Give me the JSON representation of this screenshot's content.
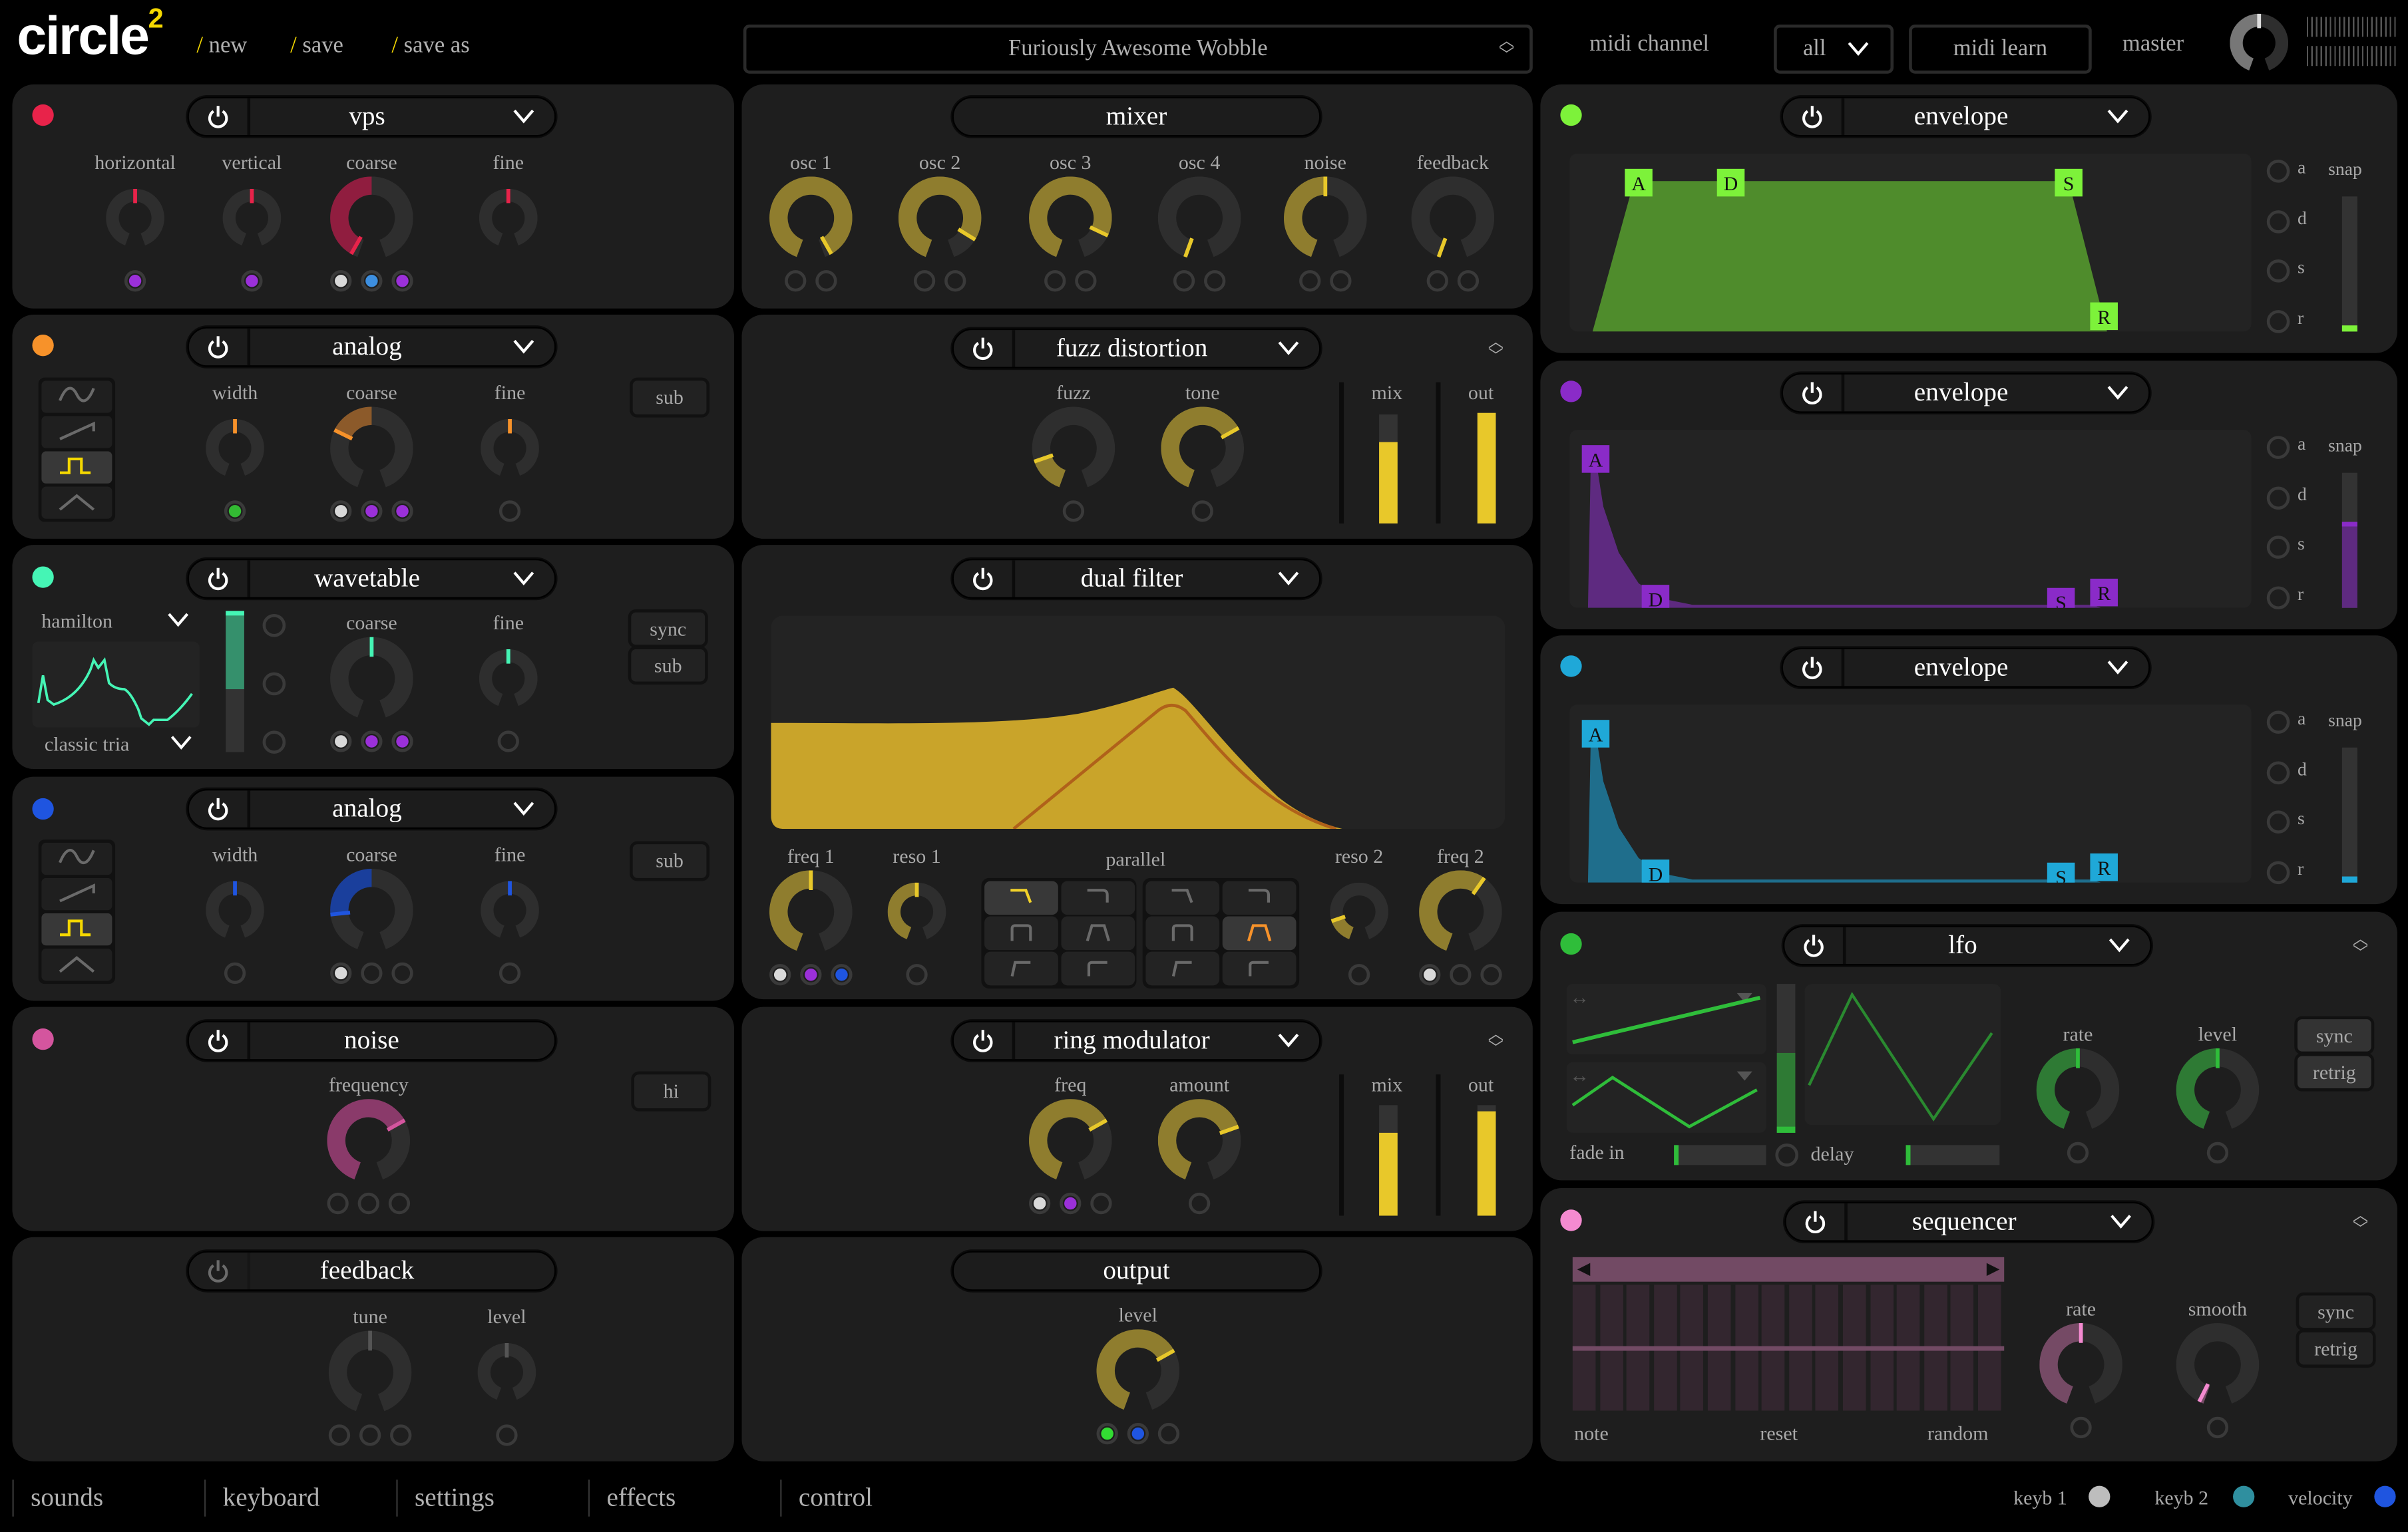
{
  "header": {
    "logo": "circle",
    "logo_sup": "2",
    "menu": [
      {
        "slash": "/",
        "label": "new"
      },
      {
        "slash": "/",
        "label": "save"
      },
      {
        "slash": "/",
        "label": "save as"
      }
    ],
    "preset": "Furiously Awesome Wobble",
    "midi_channel_label": "midi channel",
    "midi_channel_value": "all",
    "midi_learn": "midi learn",
    "master_label": "master",
    "master_level": 0.5
  },
  "left": {
    "vps": {
      "title": "vps",
      "color": "#e8234a",
      "dim": "#901d3f",
      "knobs": [
        {
          "label": "horizontal",
          "value": 0.5,
          "bipolar": true,
          "dots": [
            "#9b30d9"
          ]
        },
        {
          "label": "vertical",
          "value": 0.5,
          "bipolar": true,
          "dots": [
            "#9b30d9"
          ]
        },
        {
          "label": "coarse",
          "value": 0.03,
          "bipolar": true,
          "dots": [
            "#d9d9d9",
            "#3d8fe0",
            "#9b30d9"
          ]
        },
        {
          "label": "fine",
          "value": 0.5,
          "bipolar": true,
          "dots": []
        }
      ]
    },
    "analog1": {
      "title": "analog",
      "color": "#f7922a",
      "dim": "#8c5a2a",
      "sub": "sub",
      "waveforms": [
        "sine",
        "saw",
        "square",
        "triangle"
      ],
      "selected_waveform": 2,
      "knobs": [
        {
          "label": "width",
          "value": 0.5,
          "bipolar": true,
          "dots": [
            "#33bb33"
          ]
        },
        {
          "label": "coarse",
          "value": 0.3,
          "bipolar": true,
          "dots": [
            "#d9d9d9",
            "#9b30d9",
            "#9b30d9"
          ]
        },
        {
          "label": "fine",
          "value": 0.5,
          "bipolar": true,
          "dots": [
            null
          ]
        }
      ]
    },
    "wavetable": {
      "title": "wavetable",
      "color": "#45f5b5",
      "dim": "#2e8a6c",
      "table": "hamilton",
      "wave": "classic tria",
      "position": 0.5,
      "sync": "sync",
      "sub": "sub",
      "knobs": [
        {
          "label": "coarse",
          "value": 0.5,
          "bipolar": true,
          "dots": [
            "#d9d9d9",
            "#9b30d9",
            "#9b30d9"
          ]
        },
        {
          "label": "fine",
          "value": 0.5,
          "bipolar": true,
          "dots": [
            null
          ]
        }
      ]
    },
    "analog2": {
      "title": "analog",
      "color": "#1f55e0",
      "dim": "#1a3f9c",
      "sub": "sub",
      "waveforms": [
        "sine",
        "saw",
        "square",
        "triangle"
      ],
      "selected_waveform": 2,
      "knobs": [
        {
          "label": "width",
          "value": 0.5,
          "bipolar": true,
          "dots": [
            null
          ]
        },
        {
          "label": "coarse",
          "value": 0.2,
          "bipolar": true,
          "dots": [
            "#d9d9d9",
            null,
            null
          ]
        },
        {
          "label": "fine",
          "value": 0.5,
          "bipolar": true,
          "dots": [
            null
          ]
        }
      ]
    },
    "noise": {
      "title": "noise",
      "color": "#d4559e",
      "dim": "#8a3a6a",
      "hi": "hi",
      "knobs": [
        {
          "label": "frequency",
          "value": 0.69,
          "bipolar": false,
          "dots": [
            null,
            null,
            null
          ]
        }
      ]
    },
    "feedback": {
      "title": "feedback",
      "color": "#555555",
      "dim": "#2d2d2d",
      "knobs": [
        {
          "label": "tune",
          "value": 0.5,
          "bipolar": true,
          "dots": [
            null,
            null,
            null
          ]
        },
        {
          "label": "level",
          "value": 0.5,
          "bipolar": true,
          "dots": [
            null
          ]
        }
      ]
    }
  },
  "middle": {
    "mixer": {
      "title": "mixer",
      "color": "#e8c82a",
      "dim": "#8f7d2e",
      "knobs": [
        {
          "label": "osc 1",
          "value": 0.97,
          "bipolar": false,
          "dots": [
            null,
            null
          ]
        },
        {
          "label": "osc 2",
          "value": 0.88,
          "bipolar": false,
          "dots": [
            null,
            null
          ]
        },
        {
          "label": "osc 3",
          "value": 0.86,
          "bipolar": false,
          "dots": [
            null,
            null
          ]
        },
        {
          "label": "osc 4",
          "value": 0,
          "bipolar": false,
          "dots": [
            null,
            null
          ]
        },
        {
          "label": "noise",
          "value": 0.5,
          "bipolar": false,
          "dots": [
            null,
            null
          ]
        },
        {
          "label": "feedback",
          "value": 0,
          "bipolar": false,
          "dots": [
            null,
            null
          ]
        }
      ]
    },
    "fuzz": {
      "title": "fuzz distortion",
      "color": "#e8c82a",
      "dim": "#8f7d2e",
      "mix_label": "mix",
      "out_label": "out",
      "mix": 0.75,
      "out": 1.0,
      "knobs": [
        {
          "label": "fuzz",
          "value": 0.16,
          "bipolar": false,
          "dots": [
            null
          ]
        },
        {
          "label": "tone",
          "value": 0.69,
          "bipolar": false,
          "dots": [
            null
          ]
        }
      ]
    },
    "filter": {
      "title": "dual filter",
      "color": "#e8c82a",
      "dim": "#8f7d2e",
      "mode": "parallel",
      "grid": [
        [
          "lowpass-12",
          "lowpass-24",
          "lowpass-12",
          "lowpass-24"
        ],
        [
          "bandpass",
          "bandpass-wide",
          "bandpass",
          "bandpass-wide"
        ],
        [
          "highpass-12",
          "highpass-24",
          "highpass-12",
          "highpass-24"
        ]
      ],
      "selected_1": [
        0,
        0
      ],
      "selected_2": [
        1,
        3
      ],
      "color_1": "#f2d22a",
      "color_2": "#f7922a",
      "knobs": [
        {
          "label": "freq 1",
          "value": 0.5,
          "bipolar": false,
          "dots": [
            "#d9d9d9",
            "#9b30d9",
            "#1f55e0"
          ]
        },
        {
          "label": "reso 1",
          "value": 0.5,
          "bipolar": false,
          "dots": [
            null
          ]
        },
        {
          "label": "reso 2",
          "value": 0.16,
          "bipolar": false,
          "dots": [
            null
          ]
        },
        {
          "label": "freq 2",
          "value": 0.61,
          "bipolar": false,
          "dots": [
            "#d9d9d9",
            null,
            null
          ]
        }
      ]
    },
    "ring": {
      "title": "ring modulator",
      "color": "#e8c82a",
      "dim": "#8f7d2e",
      "mix_label": "mix",
      "out_label": "out",
      "mix": 0.75,
      "out": 0.95,
      "knobs": [
        {
          "label": "freq",
          "value": 0.69,
          "bipolar": false,
          "dots": [
            "#d9d9d9",
            "#9b30d9",
            null
          ]
        },
        {
          "label": "amount",
          "value": 0.72,
          "bipolar": false,
          "dots": [
            null
          ]
        }
      ]
    },
    "output": {
      "title": "output",
      "color": "#e8c82a",
      "dim": "#8f7d2e",
      "knobs": [
        {
          "label": "level",
          "value": 0.69,
          "bipolar": false,
          "dots": [
            "#33dd33",
            "#1f55e0",
            null
          ]
        }
      ]
    }
  },
  "right": {
    "env1": {
      "title": "envelope",
      "color": "#7df23a",
      "fill": "#4f8c2c",
      "handles": [
        "A",
        "D",
        "S",
        "R"
      ],
      "options": [
        "a",
        "d",
        "s",
        "r"
      ],
      "snap": "snap"
    },
    "env2": {
      "title": "envelope",
      "color": "#8a2bc8",
      "fill": "#5e2a80",
      "handles": [
        "A",
        "D",
        "S",
        "R"
      ],
      "options": [
        "a",
        "d",
        "s",
        "r"
      ],
      "snap": "snap"
    },
    "env3": {
      "title": "envelope",
      "color": "#1fa8d8",
      "fill": "#1f6e8c",
      "handles": [
        "A",
        "D",
        "S",
        "R"
      ],
      "options": [
        "a",
        "d",
        "s",
        "r"
      ],
      "snap": "snap"
    },
    "lfo": {
      "title": "lfo",
      "color": "#2fbd3a",
      "dim": "#2e7a34",
      "fade_in": "fade in",
      "delay": "delay",
      "sync": "sync",
      "retrig": "retrig",
      "knobs": [
        {
          "label": "rate",
          "value": 0.5,
          "bipolar": false,
          "dots": [
            null
          ]
        },
        {
          "label": "level",
          "value": 0.5,
          "bipolar": false,
          "dots": [
            null
          ]
        }
      ]
    },
    "seq": {
      "title": "sequencer",
      "color": "#f48ad0",
      "dim": "#754a65",
      "note": "note",
      "reset": "reset",
      "random": "random",
      "sync": "sync",
      "retrig": "retrig",
      "knobs": [
        {
          "label": "rate",
          "value": 0.5,
          "bipolar": false,
          "dots": [
            null
          ]
        },
        {
          "label": "smooth",
          "value": 0.02,
          "bipolar": false,
          "dots": [
            null
          ]
        }
      ]
    }
  },
  "bottom": {
    "tabs": [
      "sounds",
      "keyboard",
      "settings",
      "effects",
      "control"
    ],
    "sources": [
      {
        "label": "keyb 1",
        "color": "#bdbdbd"
      },
      {
        "label": "keyb 2",
        "color": "#2f8f9f"
      },
      {
        "label": "velocity",
        "color": "#1f55e0"
      }
    ]
  }
}
